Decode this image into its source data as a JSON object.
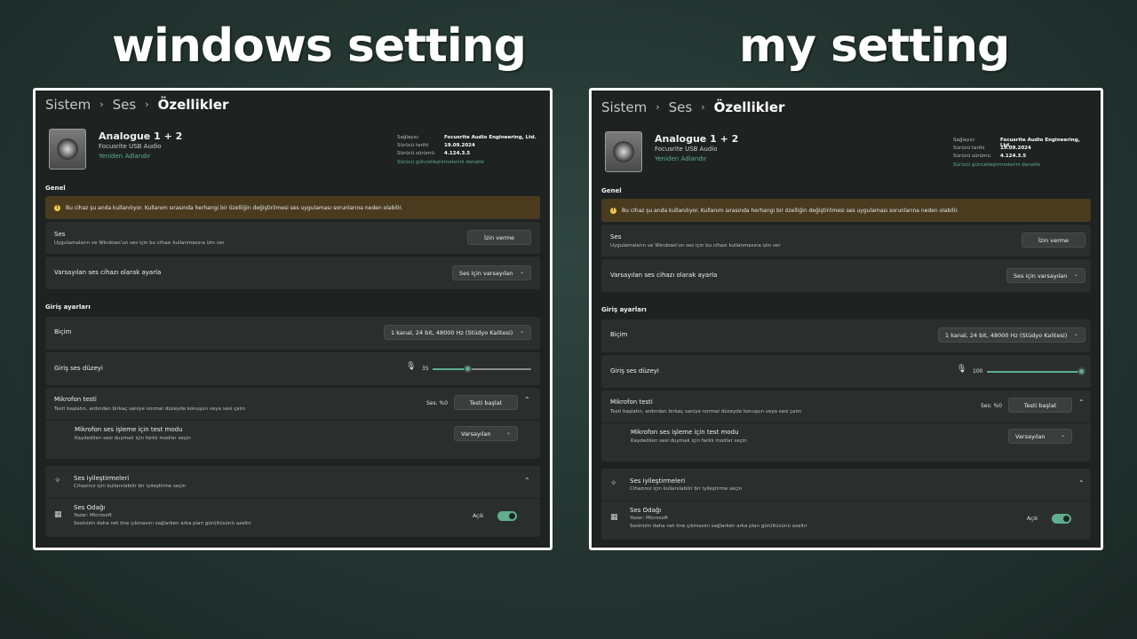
{
  "labels": {
    "left_heading": "windows setting",
    "right_heading": "my setting"
  },
  "breadcrumb": {
    "level1": "Sistem",
    "level2": "Ses",
    "current": "Özellikler",
    "sep": "›"
  },
  "device": {
    "name": "Analogue 1 + 2",
    "subtitle": "Focusrite USB Audio",
    "rename": "Yeniden Adlandır",
    "provider_label": "Sağlayıcı",
    "provider_value": "Focusrite Audio Engineering, Ltd.",
    "driver_date_label": "Sürücü tarihi",
    "driver_date_value": "19.09.2024",
    "driver_version_label": "Sürücü sürümü",
    "driver_version_value": "4.124.3.5",
    "driver_update_link": "Sürücü güncelleştirmelerini denetle"
  },
  "general": {
    "section": "Genel",
    "warning": "Bu cihaz şu anda kullanılıyor. Kullanım sırasında herhangi bir özelliğin değiştirilmesi ses uygulaması sorunlarına neden olabilir.",
    "warning_icon": "!",
    "audio_title": "Ses",
    "audio_desc": "Uygulamaların ve Windows'un ses için bu cihazı kullanmasına izin ver",
    "audio_button": "İzin verme",
    "default_title": "Varsayılan ses cihazı olarak ayarla",
    "default_dropdown": "Ses için varsayılan"
  },
  "input": {
    "section": "Giriş ayarları",
    "format_title": "Biçim",
    "format_value": "1 kanal, 24 bit, 48000 Hz (Stüdyo Kalitesi)",
    "volume_title": "Giriş ses düzeyi",
    "mic_test_title": "Mikrofon testi",
    "mic_test_desc": "Testi başlatın, ardından birkaç saniye normal düzeyde konuşun veya sesi çalın",
    "mic_test_level": "Ses: %0",
    "mic_test_button": "Testi başlat",
    "mode_title": "Mikrofon ses işleme için test modu",
    "mode_desc": "Kaydedilen sesi duymak için farklı modlar seçin",
    "mode_value": "Varsayılan"
  },
  "enhancements": {
    "title": "Ses iyileştirmeleri",
    "desc": "Cihazınız için kullanılabilir bir iyileştirme seçin",
    "studio_title": "Ses Odağı",
    "studio_author": "Yazar: Microsoft",
    "studio_desc": "Sesinizin daha net öne çıkmasını sağlarken arka plan gürültüsünü azaltır",
    "toggle_label": "Açık"
  },
  "icons": {
    "chevron_down": "⌄",
    "chevron_up": "⌃",
    "mic": "🎙",
    "enhance": "✧",
    "studio": "▦"
  },
  "panels": {
    "left": {
      "volume": 35,
      "volume_fraction": 0.35
    },
    "right": {
      "volume": 100,
      "volume_fraction": 1.0
    }
  },
  "colors": {
    "accent": "#5fae8f",
    "warning_bg": "#4a3b1f",
    "panel_bg": "#1e2321"
  }
}
